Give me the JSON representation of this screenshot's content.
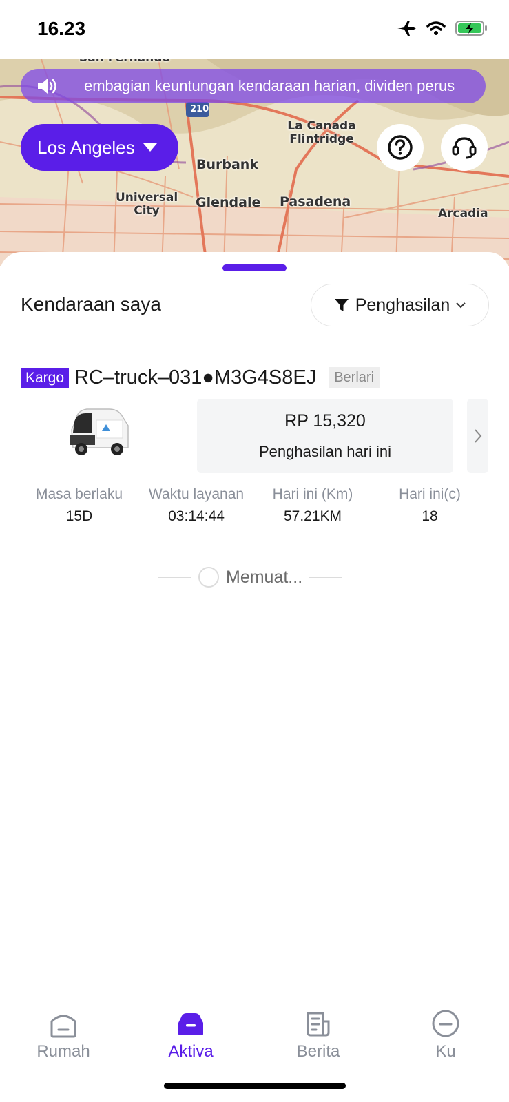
{
  "status_bar": {
    "time": "16.23",
    "icons": [
      "airplane-icon",
      "wifi-icon",
      "battery-charging-icon"
    ]
  },
  "map": {
    "labels": [
      "San Fernando",
      "La Canada Flintridge",
      "Burbank",
      "Universal City",
      "Glendale",
      "Pasadena",
      "Arcadia"
    ],
    "highway_shield": "210",
    "ticker_text": "embagian keuntungan kendaraan harian, dividen perus",
    "city_selector": "Los Angeles"
  },
  "sheet": {
    "title": "Kendaraan saya",
    "filter_label": "Penghasilan",
    "vehicle": {
      "type_tag": "Kargo",
      "name": "RC–truck–031●M3G4S8EJ",
      "status": "Berlari",
      "earnings_value": "RP 15,320",
      "earnings_label": "Penghasilan hari ini"
    },
    "stats": [
      {
        "label": "Masa berlaku",
        "value": "15D"
      },
      {
        "label": "Waktu layanan",
        "value": "03:14:44"
      },
      {
        "label": "Hari ini (Km)",
        "value": "57.21KM"
      },
      {
        "label": "Hari ini(c)",
        "value": "18"
      }
    ],
    "loading_text": "Memuat..."
  },
  "tabbar": {
    "tabs": [
      {
        "label": "Rumah",
        "icon": "home-icon",
        "active": false
      },
      {
        "label": "Aktiva",
        "icon": "car-icon",
        "active": true
      },
      {
        "label": "Berita",
        "icon": "news-icon",
        "active": false
      },
      {
        "label": "Ku",
        "icon": "profile-icon",
        "active": false
      }
    ]
  },
  "colors": {
    "accent": "#5a1ee8",
    "ticker_bg": "#7e48e8",
    "muted": "#8a8f99"
  }
}
